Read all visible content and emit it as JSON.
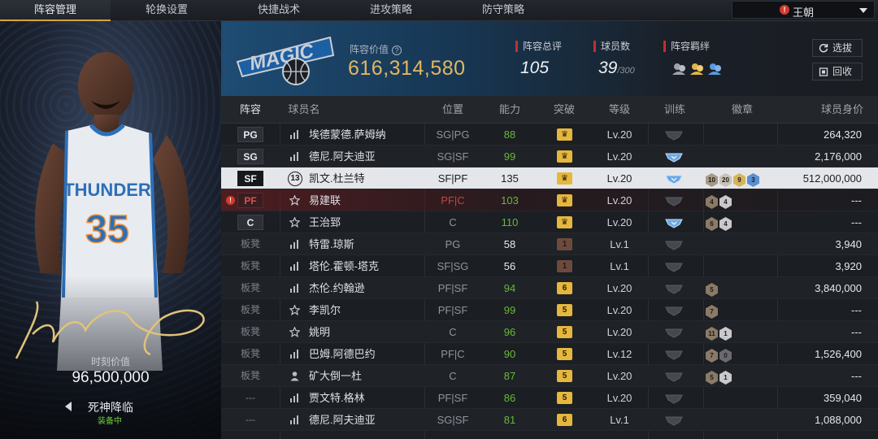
{
  "tabs": [
    {
      "label": "阵容管理",
      "active": true
    },
    {
      "label": "轮换设置",
      "active": false
    },
    {
      "label": "快捷战术",
      "active": false
    },
    {
      "label": "进攻策略",
      "active": false
    },
    {
      "label": "防守策略",
      "active": false
    }
  ],
  "team_select": {
    "alert": "!",
    "name": "王朝"
  },
  "player_card": {
    "jersey_team": "THUNDER",
    "jersey_number": "35",
    "moment_label": "时刻价值",
    "moment_value": "96,500,000",
    "skill_name": "死神降临",
    "skill_status": "装备中"
  },
  "header": {
    "logo_text": "MAGIC",
    "value_label": "阵容价值",
    "help_icon": "?",
    "value": "616,314,580",
    "overall_label": "阵容总评",
    "overall_value": "105",
    "player_count_label": "球员数",
    "player_count_value": "39",
    "player_count_max": "/300",
    "bond_label": "阵容羁绊",
    "btn_draft": "选拔",
    "btn_recycle": "回收"
  },
  "columns": [
    "阵容",
    "球员名",
    "位置",
    "能力",
    "突破",
    "等级",
    "训练",
    "徽章",
    "球员身价"
  ],
  "rows": [
    {
      "slot": "PG",
      "type": "starter",
      "state": "normal",
      "icon": "bars",
      "name": "埃德蒙德.萨姆纳",
      "pos": "SG|PG",
      "pos_red": false,
      "power": "88",
      "power_style": "green",
      "break": "",
      "break_style": "gold",
      "level": "Lv.20",
      "train": "gray",
      "badges": [],
      "salary": "264,320"
    },
    {
      "slot": "SG",
      "type": "starter",
      "state": "normal",
      "icon": "bars",
      "name": "德尼.阿夫迪亚",
      "pos": "SG|SF",
      "pos_red": false,
      "power": "99",
      "power_style": "green",
      "break": "",
      "break_style": "gold",
      "level": "Lv.20",
      "train": "blue",
      "badges": [],
      "salary": "2,176,000"
    },
    {
      "slot": "SF",
      "type": "starter",
      "state": "selected",
      "icon": "number",
      "icon_text": "13",
      "name": "凯文.杜兰特",
      "pos": "SF|PF",
      "pos_red": false,
      "power": "135",
      "power_style": "white",
      "break": "",
      "break_style": "gold",
      "level": "Lv.20",
      "train": "blue",
      "badges": [
        {
          "t": "10",
          "c": "#a99a84"
        },
        {
          "t": "20",
          "c": "#c9c2b4"
        },
        {
          "t": "9",
          "c": "#d5b45a"
        },
        {
          "t": "3",
          "c": "#5a8fd0"
        }
      ],
      "salary": "512,000,000"
    },
    {
      "slot": "PF",
      "type": "starter",
      "state": "warn",
      "icon": "star",
      "name": "易建联",
      "pos": "PF|C",
      "pos_red": true,
      "power": "103",
      "power_style": "green",
      "break": "",
      "break_style": "gold",
      "level": "Lv.20",
      "train": "gray",
      "badges": [
        {
          "t": "4",
          "c": "#8a7a66"
        },
        {
          "t": "4",
          "c": "#c9c9cc"
        }
      ],
      "salary": "---"
    },
    {
      "slot": "C",
      "type": "starter",
      "state": "normal",
      "icon": "star",
      "name": "王治郅",
      "pos": "C",
      "pos_red": false,
      "power": "110",
      "power_style": "green",
      "break": "",
      "break_style": "gold",
      "level": "Lv.20",
      "train": "blue",
      "badges": [
        {
          "t": "6",
          "c": "#8a7a66"
        },
        {
          "t": "4",
          "c": "#c9c9cc"
        }
      ],
      "salary": "---"
    },
    {
      "slot": "板凳",
      "type": "bench",
      "state": "normal",
      "icon": "bars",
      "name": "特雷.琼斯",
      "pos": "PG",
      "pos_red": false,
      "power": "58",
      "power_style": "white",
      "break": "1",
      "break_style": "brown",
      "level": "Lv.1",
      "train": "gray",
      "badges": [],
      "salary": "3,940"
    },
    {
      "slot": "板凳",
      "type": "bench",
      "state": "normal",
      "icon": "bars",
      "name": "塔伦.霍顿-塔克",
      "pos": "SF|SG",
      "pos_red": false,
      "power": "56",
      "power_style": "white",
      "break": "1",
      "break_style": "brown",
      "level": "Lv.1",
      "train": "gray",
      "badges": [],
      "salary": "3,920"
    },
    {
      "slot": "板凳",
      "type": "bench",
      "state": "normal",
      "icon": "bars",
      "name": "杰伦.约翰逊",
      "pos": "PF|SF",
      "pos_red": false,
      "power": "94",
      "power_style": "green",
      "break": "6",
      "break_style": "gold",
      "level": "Lv.20",
      "train": "gray",
      "badges": [
        {
          "t": "5",
          "c": "#8a7a66"
        }
      ],
      "salary": "3,840,000"
    },
    {
      "slot": "板凳",
      "type": "bench",
      "state": "normal",
      "icon": "star",
      "name": "李凯尔",
      "pos": "PF|SF",
      "pos_red": false,
      "power": "99",
      "power_style": "green",
      "break": "5",
      "break_style": "gold",
      "level": "Lv.20",
      "train": "gray",
      "badges": [
        {
          "t": "7",
          "c": "#8a7a66"
        }
      ],
      "salary": "---"
    },
    {
      "slot": "板凳",
      "type": "bench",
      "state": "normal",
      "icon": "star",
      "name": "姚明",
      "pos": "C",
      "pos_red": false,
      "power": "96",
      "power_style": "green",
      "break": "5",
      "break_style": "gold",
      "level": "Lv.20",
      "train": "gray",
      "badges": [
        {
          "t": "11",
          "c": "#8a7a66"
        },
        {
          "t": "1",
          "c": "#c9c9cc"
        }
      ],
      "salary": "---"
    },
    {
      "slot": "板凳",
      "type": "bench",
      "state": "normal",
      "icon": "bars",
      "name": "巴姆.阿德巴约",
      "pos": "PF|C",
      "pos_red": false,
      "power": "90",
      "power_style": "green",
      "break": "5",
      "break_style": "gold",
      "level": "Lv.12",
      "train": "gray",
      "badges": [
        {
          "t": "7",
          "c": "#8a7a66"
        },
        {
          "t": "0",
          "c": "#6a6a6e"
        }
      ],
      "salary": "1,526,400"
    },
    {
      "slot": "板凳",
      "type": "bench",
      "state": "normal",
      "icon": "person",
      "name": "矿大倒一杜",
      "pos": "C",
      "pos_red": false,
      "power": "87",
      "power_style": "green",
      "break": "5",
      "break_style": "gold",
      "level": "Lv.20",
      "train": "gray",
      "badges": [
        {
          "t": "5",
          "c": "#8a7a66"
        },
        {
          "t": "1",
          "c": "#c9c9cc"
        }
      ],
      "salary": "---"
    },
    {
      "slot": "---",
      "type": "bench",
      "state": "normal",
      "icon": "bars",
      "name": "贾文特.格林",
      "pos": "PF|SF",
      "pos_red": false,
      "power": "86",
      "power_style": "green",
      "break": "5",
      "break_style": "gold",
      "level": "Lv.20",
      "train": "gray",
      "badges": [],
      "salary": "359,040"
    },
    {
      "slot": "---",
      "type": "bench",
      "state": "normal",
      "icon": "bars",
      "name": "德尼.阿夫迪亚",
      "pos": "SG|SF",
      "pos_red": false,
      "power": "81",
      "power_style": "green",
      "break": "6",
      "break_style": "gold",
      "level": "Lv.1",
      "train": "gray",
      "badges": [],
      "salary": "1,088,000"
    }
  ]
}
